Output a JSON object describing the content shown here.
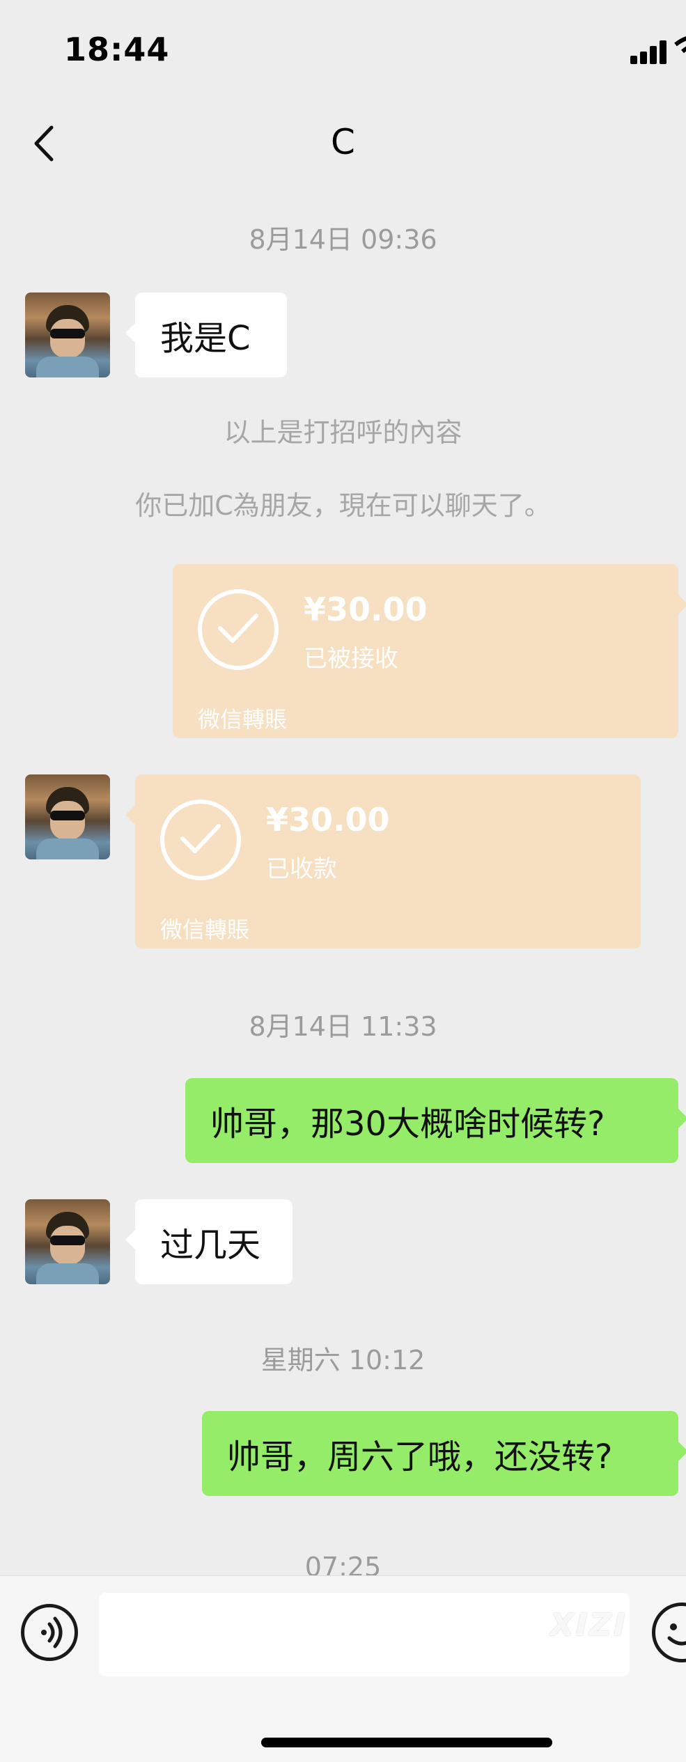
{
  "status_bar": {
    "time": "18:44"
  },
  "header": {
    "title": "C"
  },
  "timestamps": {
    "t1": "8月14日 09:36",
    "t2": "8月14日 11:33",
    "t3": "星期六 10:12",
    "t4": "07:25"
  },
  "system_messages": {
    "greeting_note": "以上是打招呼的內容",
    "friend_added": "你已加C為朋友，現在可以聊天了。"
  },
  "messages": {
    "m1": "我是C",
    "m2": "帅哥，那30大概啥时候转?",
    "m3": "过几天",
    "m4": "帅哥，周六了哦，还没转?"
  },
  "transfers": {
    "sent": {
      "amount": "¥30.00",
      "status": "已被接收",
      "brand": "微信轉賬"
    },
    "received": {
      "amount": "¥30.00",
      "status": "已收款",
      "brand": "微信轉賬"
    }
  },
  "input": {
    "placeholder": ""
  },
  "watermark": "XIZI",
  "colors": {
    "background": "#ededed",
    "sent_bubble": "#95ec69",
    "received_bubble": "#ffffff",
    "transfer_card": "#f7dfc2"
  },
  "icons": [
    "back-icon",
    "signal-icon",
    "wifi-icon",
    "voice-icon",
    "emoji-icon",
    "check-icon"
  ]
}
